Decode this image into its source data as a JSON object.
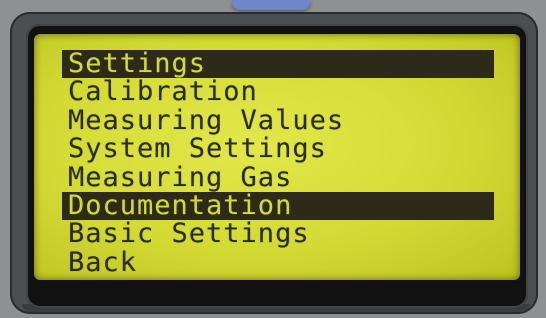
{
  "device": {
    "screen": {
      "menu": {
        "items": [
          {
            "label": "Settings",
            "selected": true
          },
          {
            "label": "Calibration",
            "selected": false
          },
          {
            "label": "Measuring Values",
            "selected": false
          },
          {
            "label": "System Settings",
            "selected": false
          },
          {
            "label": "Measuring Gas",
            "selected": false
          },
          {
            "label": "Documentation",
            "selected": true
          },
          {
            "label": "Basic Settings",
            "selected": false
          },
          {
            "label": "Back",
            "selected": false
          }
        ]
      }
    }
  },
  "colors": {
    "lcd_background": "#d4da34",
    "lcd_text": "#2b2c17",
    "highlight": "#2d2a19",
    "bezel": "#4c4f51",
    "top_tab": "#6f86c9"
  }
}
